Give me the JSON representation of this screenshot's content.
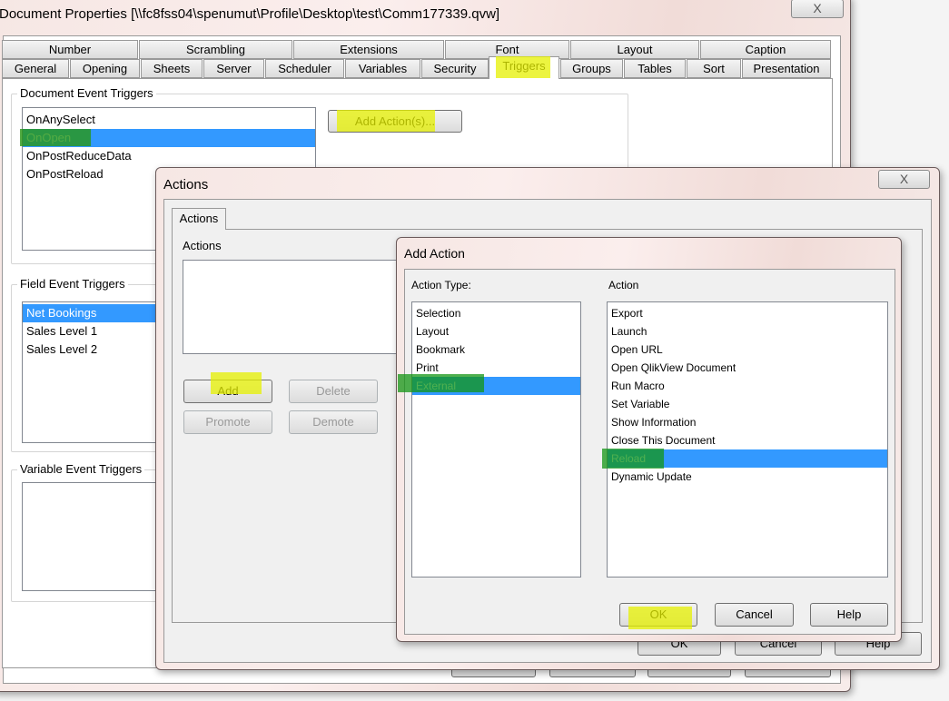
{
  "main_window": {
    "title": "Document Properties [\\\\fc8fss04\\spenumut\\Profile\\Desktop\\test\\Comm177339.qvw]",
    "close_label": "X",
    "tabs_row1": [
      "Number",
      "Scrambling",
      "Extensions",
      "Font",
      "Layout",
      "Caption"
    ],
    "tabs_row2": [
      "General",
      "Opening",
      "Sheets",
      "Server",
      "Scheduler",
      "Variables",
      "Security",
      "Triggers",
      "Groups",
      "Tables",
      "Sort",
      "Presentation"
    ],
    "selected_tab": "Triggers",
    "document_event_triggers": {
      "label": "Document Event Triggers",
      "items": [
        "OnAnySelect",
        "OnOpen",
        "OnPostReduceData",
        "OnPostReload"
      ],
      "selected": "OnOpen",
      "add_actions_label": "Add Action(s)..."
    },
    "field_event_triggers": {
      "label": "Field Event Triggers",
      "items": [
        "Net Bookings",
        "Sales Level 1",
        "Sales Level 2"
      ],
      "selected": "Net Bookings"
    },
    "variable_event_triggers": {
      "label": "Variable Event Triggers",
      "items": []
    }
  },
  "actions_dialog": {
    "title": "Actions",
    "close_label": "X",
    "tab": "Actions",
    "actions_label": "Actions",
    "buttons": {
      "add": "Add",
      "delete": "Delete",
      "promote": "Promote",
      "demote": "Demote",
      "ok": "OK",
      "cancel": "Cancel",
      "help": "Help"
    }
  },
  "add_action_dialog": {
    "title": "Add Action",
    "action_type_label": "Action Type:",
    "action_label": "Action",
    "action_types": [
      "Selection",
      "Layout",
      "Bookmark",
      "Print",
      "External"
    ],
    "selected_action_type": "External",
    "actions": [
      "Export",
      "Launch",
      "Open URL",
      "Open QlikView Document",
      "Run Macro",
      "Set Variable",
      "Show Information",
      "Close This Document",
      "Reload",
      "Dynamic Update"
    ],
    "selected_action": "Reload",
    "buttons": {
      "ok": "OK",
      "cancel": "Cancel",
      "help": "Help"
    }
  },
  "colors": {
    "selection": "#3399ff",
    "highlighter_yellow": "#e6f000",
    "highlighter_green": "#149614"
  }
}
